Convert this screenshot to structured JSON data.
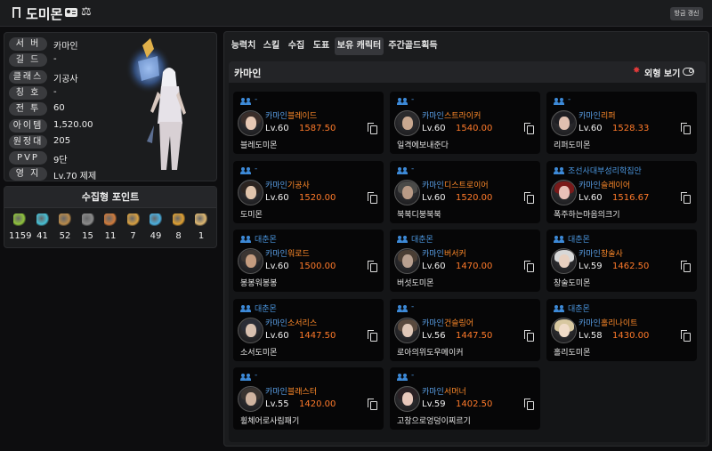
{
  "header": {
    "name": "도미몬",
    "refresh_label": "방금 갱신"
  },
  "profile": {
    "rows": [
      {
        "key": "서 버",
        "value": "카마인"
      },
      {
        "key": "길 드",
        "value": "-"
      },
      {
        "key": "클래스",
        "value": "기공사"
      },
      {
        "key": "칭 호",
        "value": "-"
      },
      {
        "key": "전 투",
        "value": "60"
      },
      {
        "key": "아이템",
        "value": "1,520.00"
      },
      {
        "key": "원정대",
        "value": "205"
      },
      {
        "key": "PVP",
        "value": "9단"
      },
      {
        "key": "영 지",
        "value": "Lv.70 제제"
      }
    ]
  },
  "collection": {
    "title": "수집형 포인트",
    "items": [
      {
        "icon": "mokoko-seed-icon",
        "value": "1159",
        "color": "#8fc43a"
      },
      {
        "icon": "island-heart-icon",
        "value": "41",
        "color": "#46c1d6"
      },
      {
        "icon": "masterpiece-icon",
        "value": "52",
        "color": "#b98a4a"
      },
      {
        "icon": "giant-heart-icon",
        "value": "15",
        "color": "#8a8a8a"
      },
      {
        "icon": "ignea-token-icon",
        "value": "11",
        "color": "#d07a3a"
      },
      {
        "icon": "adventure-book-icon",
        "value": "7",
        "color": "#d9a040"
      },
      {
        "icon": "world-tree-leaf-icon",
        "value": "49",
        "color": "#4ab0e0"
      },
      {
        "icon": "sea-bounty-icon",
        "value": "8",
        "color": "#e0a030"
      },
      {
        "icon": "orpheus-star-icon",
        "value": "1",
        "color": "#e0b870"
      }
    ]
  },
  "tabs": [
    {
      "label": "능력치",
      "active": false
    },
    {
      "label": "스킬",
      "active": false
    },
    {
      "label": "수집",
      "active": false
    },
    {
      "label": "도표",
      "active": false
    },
    {
      "label": "보유 캐릭터",
      "active": true
    },
    {
      "label": "주간골드획득",
      "active": false
    }
  ],
  "roster": {
    "server_title": "카마인",
    "look_label": "외형 보기",
    "characters": [
      {
        "guild": "-",
        "server": "카마인",
        "cls": "블레이드",
        "lv": "Lv.60",
        "ilvl": "1587.50",
        "name": "블레도미몬"
      },
      {
        "guild": "-",
        "server": "카마인",
        "cls": "스트라이커",
        "lv": "Lv.60",
        "ilvl": "1540.00",
        "name": "일격에보내준다"
      },
      {
        "guild": "-",
        "server": "카마인",
        "cls": "리퍼",
        "lv": "Lv.60",
        "ilvl": "1528.33",
        "name": "리퍼도미몬"
      },
      {
        "guild": "-",
        "server": "카마인",
        "cls": "기공사",
        "lv": "Lv.60",
        "ilvl": "1520.00",
        "name": "도미몬"
      },
      {
        "guild": "-",
        "server": "카마인",
        "cls": "디스트로이어",
        "lv": "Lv.60",
        "ilvl": "1520.00",
        "name": "북북디붕북북"
      },
      {
        "guild": "조선사대부성리학집안",
        "server": "카마인",
        "cls": "슬레이어",
        "lv": "Lv.60",
        "ilvl": "1516.67",
        "name": "폭주하는마음의크기"
      },
      {
        "guild": "대춘몬",
        "server": "카마인",
        "cls": "워로드",
        "lv": "Lv.60",
        "ilvl": "1500.00",
        "name": "봉봉워봉봉"
      },
      {
        "guild": "대춘몬",
        "server": "카마인",
        "cls": "버서커",
        "lv": "Lv.60",
        "ilvl": "1470.00",
        "name": "버섯도미몬"
      },
      {
        "guild": "대춘몬",
        "server": "카마인",
        "cls": "창술사",
        "lv": "Lv.59",
        "ilvl": "1462.50",
        "name": "창술도미몬"
      },
      {
        "guild": "대춘몬",
        "server": "카마인",
        "cls": "소서리스",
        "lv": "Lv.60",
        "ilvl": "1447.50",
        "name": "소서도미몬"
      },
      {
        "guild": "-",
        "server": "카마인",
        "cls": "건슬링어",
        "lv": "Lv.56",
        "ilvl": "1447.50",
        "name": "로아의위도우메이커"
      },
      {
        "guild": "대춘몬",
        "server": "카마인",
        "cls": "홀리나이트",
        "lv": "Lv.58",
        "ilvl": "1430.00",
        "name": "홀리도미몬"
      },
      {
        "guild": "-",
        "server": "카마인",
        "cls": "블래스터",
        "lv": "Lv.55",
        "ilvl": "1420.00",
        "name": "휠체어로사림패기"
      },
      {
        "guild": "-",
        "server": "카마인",
        "cls": "서머너",
        "lv": "Lv.59",
        "ilvl": "1402.50",
        "name": "고창으로엉덩이찌르기"
      }
    ]
  }
}
